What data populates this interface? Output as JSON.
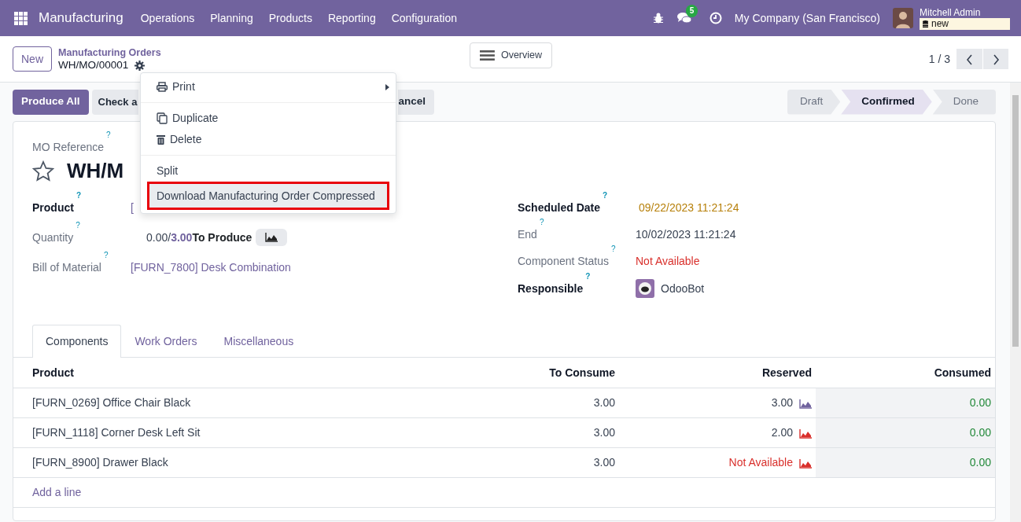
{
  "navbar": {
    "app": "Manufacturing",
    "menus": [
      "Operations",
      "Planning",
      "Products",
      "Reporting",
      "Configuration"
    ],
    "message_count": "5",
    "company": "My Company (San Francisco)",
    "user": "Mitchell Admin",
    "database": "new"
  },
  "control_panel": {
    "new_button": "New",
    "breadcrumb_parent": "Manufacturing Orders",
    "breadcrumb_current": "WH/MO/00001",
    "overview_button": "Overview",
    "pager": "1 / 3"
  },
  "actions": [
    {
      "label": "Produce All",
      "kind": "primary"
    },
    {
      "label": "Check a",
      "kind": "secondary"
    },
    {
      "label": "ancel",
      "kind": "secondary"
    }
  ],
  "stages": [
    {
      "label": "Draft",
      "selected": false
    },
    {
      "label": "Confirmed",
      "selected": true
    },
    {
      "label": "Done",
      "selected": false
    }
  ],
  "dropdown": {
    "sections": [
      [
        {
          "label": "Print",
          "kind": "print",
          "submenu": true,
          "highlighted": false
        }
      ],
      [
        {
          "label": "Duplicate",
          "kind": "duplicate",
          "submenu": false,
          "highlighted": false
        },
        {
          "label": "Delete",
          "kind": "delete",
          "submenu": false,
          "highlighted": false
        }
      ],
      [
        {
          "label": "Split",
          "kind": "plain",
          "submenu": false,
          "highlighted": false
        },
        {
          "label": "Download Manufacturing Order Compressed",
          "kind": "plain",
          "submenu": false,
          "highlighted": true
        }
      ]
    ]
  },
  "form": {
    "reference_label": "MO Reference",
    "reference_help": "?",
    "starred": false,
    "title": "WH/M",
    "left_fields": [
      {
        "label": "Product",
        "help": "?",
        "required": true,
        "kind": "link",
        "value": "["
      },
      {
        "label": "Quantity",
        "help": "?",
        "required": false,
        "kind": "quantity",
        "produced": "0.00",
        "separator": "/",
        "planned": "3.00",
        "unit_label": "To Produce"
      },
      {
        "label": "Bill of Material",
        "help": "?",
        "required": false,
        "kind": "link",
        "value": "[FURN_7800] Desk Combination"
      }
    ],
    "right_fields": [
      {
        "label": "Scheduled Date",
        "help": "?",
        "required": true,
        "kind": "warning",
        "value": "09/22/2023 11:21:24"
      },
      {
        "label": "End",
        "help": "?",
        "required": false,
        "kind": "text",
        "value": "10/02/2023 11:21:24"
      },
      {
        "label": "Component Status",
        "help": "?",
        "required": false,
        "kind": "danger",
        "value": "Not Available"
      },
      {
        "label": "Responsible",
        "help": "?",
        "required": true,
        "kind": "user",
        "value": "OdooBot"
      }
    ]
  },
  "tabs": [
    {
      "label": "Components",
      "selected": true
    },
    {
      "label": "Work Orders",
      "selected": false
    },
    {
      "label": "Miscellaneous",
      "selected": false
    }
  ],
  "table": {
    "columns": [
      "Product",
      "To Consume",
      "Reserved",
      "Consumed"
    ],
    "rows": [
      {
        "product": "[FURN_0269] Office Chair Black",
        "to_consume": "3.00",
        "reserved": "3.00",
        "reserved_available": true,
        "color": "#71639e",
        "consumed": "0.00"
      },
      {
        "product": "[FURN_1118] Corner Desk Left Sit",
        "to_consume": "3.00",
        "reserved": "2.00",
        "reserved_available": true,
        "color": "#d9302c",
        "consumed": "0.00"
      },
      {
        "product": "[FURN_8900] Drawer Black",
        "to_consume": "3.00",
        "reserved": "Not Available",
        "reserved_available": false,
        "color": "#d9302c",
        "consumed": "0.00"
      }
    ],
    "add_line": "Add a line"
  }
}
